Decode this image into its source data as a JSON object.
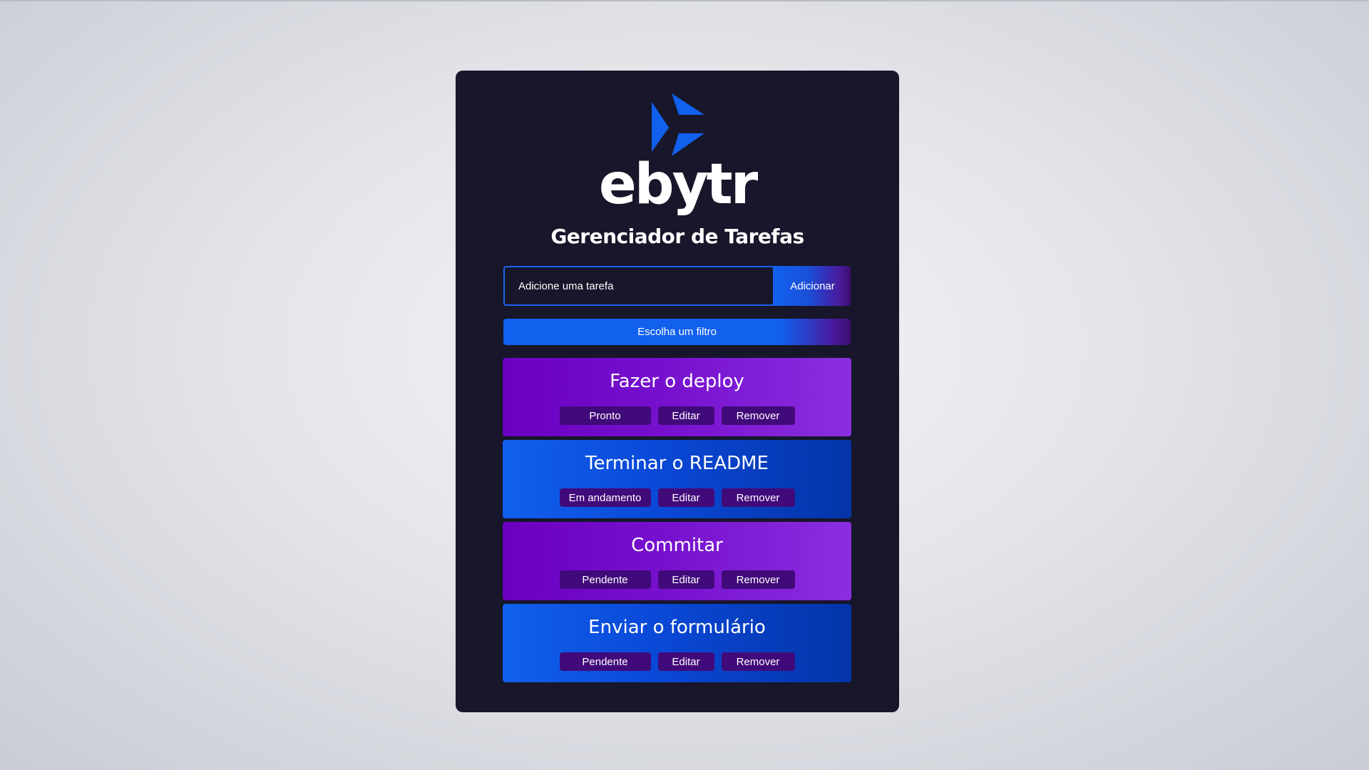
{
  "brand": {
    "name": "ebytr",
    "logo_icon": "paper-plane-arrow-icon",
    "colors": {
      "primary_blue": "#1160ee",
      "purple": "#6a00c2",
      "dark_bg": "#17162a",
      "button_dark_purple": "#410a7a"
    }
  },
  "header": {
    "title": "Gerenciador de Tarefas"
  },
  "add_task": {
    "placeholder": "Adicione uma tarefa",
    "value": "",
    "button_label": "Adicionar"
  },
  "filter": {
    "label": "Escolha um filtro"
  },
  "tasks": [
    {
      "title": "Fazer o deploy",
      "status": "Pronto",
      "edit_label": "Editar",
      "remove_label": "Remover",
      "color": "purple"
    },
    {
      "title": "Terminar o README",
      "status": "Em andamento",
      "edit_label": "Editar",
      "remove_label": "Remover",
      "color": "blue"
    },
    {
      "title": "Commitar",
      "status": "Pendente",
      "edit_label": "Editar",
      "remove_label": "Remover",
      "color": "purple"
    },
    {
      "title": "Enviar o formulário",
      "status": "Pendente",
      "edit_label": "Editar",
      "remove_label": "Remover",
      "color": "blue"
    }
  ]
}
